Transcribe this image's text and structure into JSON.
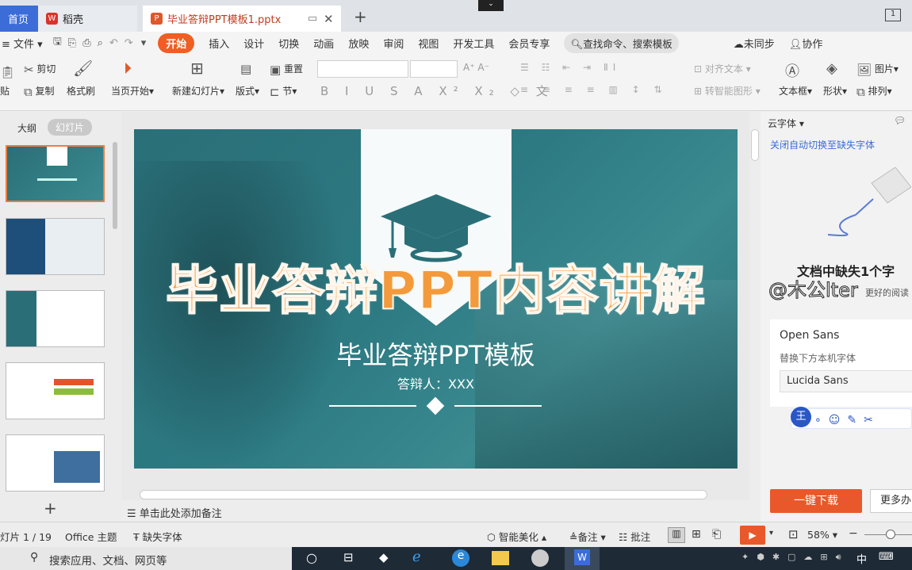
{
  "tabs": {
    "home": "首页",
    "daoke": "稻壳",
    "doc": "毕业答辩PPT模板1.pptx"
  },
  "menu": {
    "file": "文件",
    "items": [
      "开始",
      "插入",
      "设计",
      "切换",
      "动画",
      "放映",
      "审阅",
      "视图",
      "开发工具",
      "会员专享"
    ],
    "search": "查找命令、搜索模板",
    "sync": "未同步",
    "collab": "协作"
  },
  "toolbar": {
    "cut": "剪切",
    "copy": "复制",
    "paste": "贴",
    "format_brush": "格式刷",
    "from_current": "当页开始",
    "new_slide": "新建幻灯片",
    "layout": "版式",
    "reset": "重置",
    "section": "节",
    "align_text": "对齐文本",
    "smart_art": "转智能图形",
    "textbox": "文本框",
    "shape": "形状",
    "picture": "图片",
    "arrange": "排列"
  },
  "leftpanel": {
    "outline_tab": "大纲",
    "slides_tab": "幻灯片",
    "add": "+"
  },
  "slide": {
    "main_title": "毕业答辩PPT内容讲解",
    "subtitle": "毕业答辩PPT模板",
    "presenter": "答辩人：XXX"
  },
  "notes": "单击此处添加备注",
  "rightpanel": {
    "cloud_font": "云字体",
    "auto_switch": "关闭自动切换至缺失字体",
    "missing_title": "文档中缺失1个字",
    "missing_sub": "更好的阅读",
    "watermark": "@木公lter",
    "font_open": "Open Sans",
    "replace_label": "替换下方本机字体",
    "font_lucida": "Lucida Sans",
    "download_btn": "一键下载",
    "more_btn": "更多办"
  },
  "status": {
    "slide_count": "灯片 1 / 19",
    "theme": "Office 主题",
    "missing_font": "缺失字体",
    "beautify": "智能美化",
    "notes": "备注",
    "comments": "批注",
    "zoom": "58%"
  },
  "taskbar": {
    "search": "搜索应用、文档、网页等",
    "ime": "中"
  },
  "colors": {
    "accent": "#f05e23",
    "slide_bg": "#2a6f78",
    "title_orange": "#f29a3c",
    "home_blue": "#3b6cd8"
  }
}
